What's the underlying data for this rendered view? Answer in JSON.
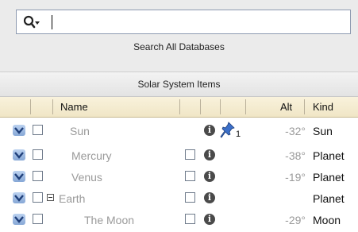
{
  "search": {
    "value": "",
    "placeholder": "",
    "search_all_label": "Search All Databases"
  },
  "section": {
    "title": "Solar System Items"
  },
  "columns": {
    "name": "Name",
    "alt": "Alt",
    "kind": "Kind"
  },
  "rows": [
    {
      "name": "Sun",
      "alt": "-32°",
      "kind": "Sun",
      "pin_count": "1"
    },
    {
      "name": "Mercury",
      "alt": "-38°",
      "kind": "Planet"
    },
    {
      "name": "Venus",
      "alt": "-19°",
      "kind": "Planet"
    },
    {
      "name": "Earth",
      "alt": "",
      "kind": "Planet"
    },
    {
      "name": "The Moon",
      "alt": "-29°",
      "kind": "Moon"
    }
  ],
  "colors": {
    "chevron_bg": "#86a7d6",
    "dim_text": "#9a9a9a",
    "pin_blue": "#3b6fc9"
  }
}
